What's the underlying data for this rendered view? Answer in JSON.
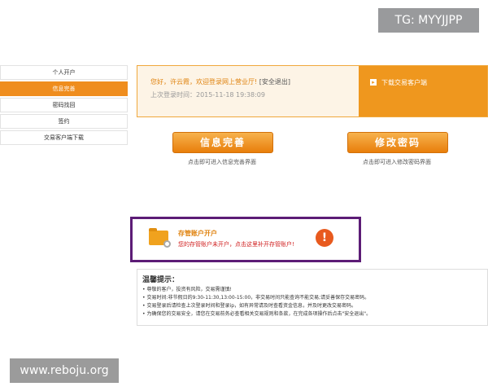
{
  "watermarks": {
    "top": "TG: MYYJJPP",
    "bottom": "www.reboju.org"
  },
  "sidebar": {
    "items": [
      {
        "label": "个人开户",
        "active": false
      },
      {
        "label": "信息完善",
        "active": true
      },
      {
        "label": "密码找回",
        "active": false
      },
      {
        "label": "签约",
        "active": false
      },
      {
        "label": "交易客户端下载",
        "active": false
      }
    ]
  },
  "welcome": {
    "greeting": "您好，许云霞，欢迎登录网上营业厅!",
    "logout": "[安全退出]",
    "last_login_label": "上次登录时间：",
    "last_login_time": "2015-11-18 19:38:09",
    "download_label": "下载交易客户端"
  },
  "actions": {
    "info": {
      "label": "信息完善",
      "desc": "点击即可进入信息完善界面"
    },
    "password": {
      "label": "修改密码",
      "desc": "点击即可进入修改密码界面"
    }
  },
  "custody": {
    "title": "存管账户开户",
    "message": "您的存管账户未开户，点击这里补开存管账户!",
    "alert_symbol": "!"
  },
  "tips": {
    "heading": "温馨提示：",
    "lines": [
      "尊敬的客户，投资有风险，交易需谨慎!",
      "交易时间:非节假日的9:30-11:30,13:00-15:00，非交易时间只能查询不能交易;请妥善保存交易密码。",
      "交易登录后请检查上次登录时间和登录ip，如有异常请及时查看资金信息，并及时更改交易密码。",
      "为确保您的交易安全，请您在交易前务必查看相关交易规则和条款，在完成各项操作后点击\"安全退出\"。"
    ]
  },
  "colors": {
    "accent": "#ef8d1e",
    "highlight_border": "#5c1c76",
    "alert": "#e85a1e"
  }
}
